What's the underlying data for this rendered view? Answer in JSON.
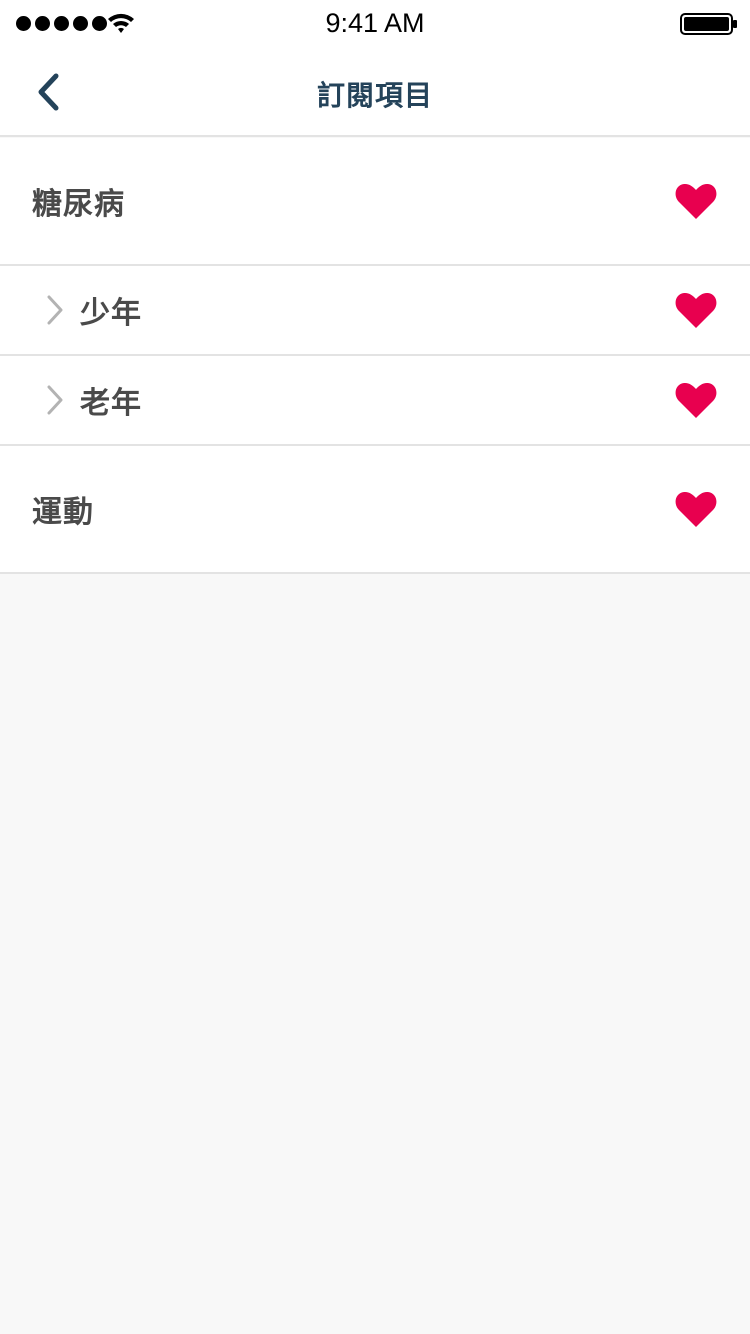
{
  "status_bar": {
    "time": "9:41 AM"
  },
  "nav": {
    "title": "訂閱項目",
    "back_icon": "chevron-left-icon"
  },
  "colors": {
    "accent": "#24435a",
    "heart": "#e8004f",
    "chevron": "#b3b3b3"
  },
  "list": {
    "items": [
      {
        "label": "糖尿病",
        "level": "parent",
        "subscribed": true,
        "icon": "heart-icon"
      },
      {
        "label": "少年",
        "level": "child",
        "subscribed": true,
        "icon": "heart-icon"
      },
      {
        "label": "老年",
        "level": "child",
        "subscribed": true,
        "icon": "heart-icon"
      },
      {
        "label": "運動",
        "level": "parent",
        "subscribed": true,
        "icon": "heart-icon"
      }
    ]
  }
}
